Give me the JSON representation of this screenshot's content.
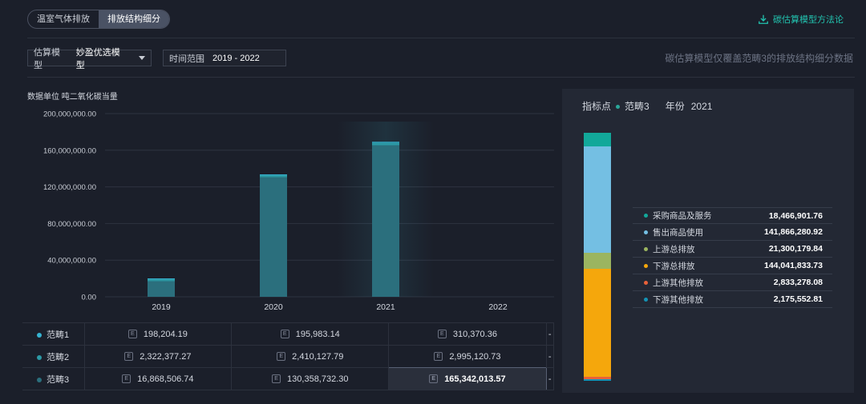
{
  "tabs": [
    {
      "label": "温室气体排放",
      "active": false
    },
    {
      "label": "排放结构细分",
      "active": true
    }
  ],
  "method_link": "碳估算模型方法论",
  "filters": {
    "model_label": "估算模型",
    "model_value": "妙盈优选模型",
    "time_label": "时间范围",
    "time_value": "2019 - 2022"
  },
  "notice": "碳估算模型仅覆盖范畴3的排放结构细分数据",
  "unit_label": "数据单位 吨二氧化碳当量",
  "chart_data": {
    "type": "bar",
    "categories": [
      "2019",
      "2020",
      "2021",
      "2022"
    ],
    "series": [
      {
        "name": "范畴1",
        "values": [
          198204.19,
          195983.14,
          310370.36,
          null
        ],
        "color": "#36b4d2"
      },
      {
        "name": "范畴2",
        "values": [
          2322377.27,
          2410127.79,
          2995120.73,
          null
        ],
        "color": "#2c9aa6"
      },
      {
        "name": "范畴3",
        "values": [
          16868506.74,
          130358732.3,
          165342013.57,
          null
        ],
        "color": "#2b6f7d"
      }
    ],
    "ylim": [
      0,
      200000000
    ],
    "yticks": [
      "0.00",
      "40,000,000.00",
      "80,000,000.00",
      "120,000,000.00",
      "160,000,000.00",
      "200,000,000.00"
    ],
    "highlight_category": "2021",
    "grid": true
  },
  "table": {
    "rows": [
      {
        "label": "范畴1",
        "color": "#36b4d2",
        "cells": [
          "198,204.19",
          "195,983.14",
          "310,370.36",
          "-"
        ]
      },
      {
        "label": "范畴2",
        "color": "#2c9aa6",
        "cells": [
          "2,322,377.27",
          "2,410,127.79",
          "2,995,120.73",
          "-"
        ]
      },
      {
        "label": "范畴3",
        "color": "#2b6f7d",
        "cells": [
          "16,868,506.74",
          "130,358,732.30",
          "165,342,013.57",
          "-"
        ]
      }
    ],
    "badge": "E"
  },
  "detail": {
    "indicator_label": "指标点",
    "indicator_value": "范畴3",
    "indicator_color": "#2aa79a",
    "year_label": "年份",
    "year_value": "2021",
    "items": [
      {
        "name": "采购商品及服务",
        "value": "18,466,901.76",
        "num": 18466901.76,
        "color": "#12a89a"
      },
      {
        "name": "售出商品使用",
        "value": "141,866,280.92",
        "num": 141866280.92,
        "color": "#74bfe3"
      },
      {
        "name": "上游总排放",
        "value": "21,300,179.84",
        "num": 21300179.84,
        "color": "#9bb560"
      },
      {
        "name": "下游总排放",
        "value": "144,041,833.73",
        "num": 144041833.73,
        "color": "#f5a70c"
      },
      {
        "name": "上游其他排放",
        "value": "2,833,278.08",
        "num": 2833278.08,
        "color": "#e8613a"
      },
      {
        "name": "下游其他排放",
        "value": "2,175,552.81",
        "num": 2175552.81,
        "color": "#1493b5"
      }
    ]
  }
}
